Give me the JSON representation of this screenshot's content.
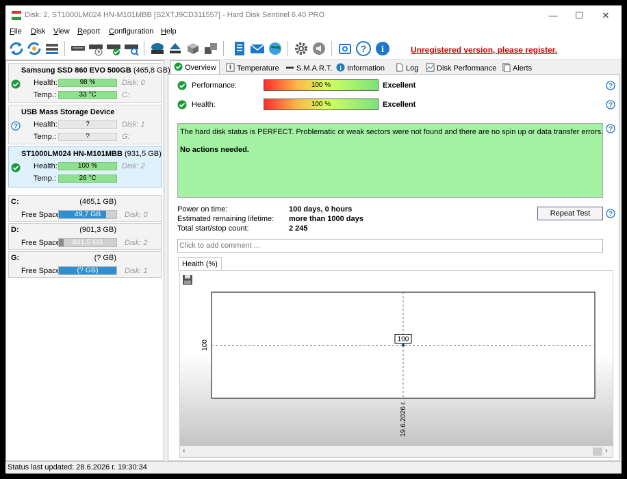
{
  "window": {
    "title": "Disk: 2, ST1000LM024 HN-M101MBB [S2XTJ9CD311557]  -  Hard Disk Sentinel 6.40 PRO"
  },
  "menu": [
    {
      "accel": "F",
      "rest": "ile"
    },
    {
      "accel": "D",
      "rest": "isk"
    },
    {
      "accel": "V",
      "rest": "iew"
    },
    {
      "accel": "R",
      "rest": "eport"
    },
    {
      "accel": "C",
      "rest": "onfiguration"
    },
    {
      "accel": "H",
      "rest": "elp"
    }
  ],
  "toolbar": {
    "register_text": "Unregistered version, please register."
  },
  "disks": [
    {
      "name": "Samsung SSD 860 EVO 500GB",
      "size": "(465,8 GB)",
      "health_label": "Health:",
      "health": "98 %",
      "temp_label": "Temp.:",
      "temp": "33 °C",
      "disk_ref": "Disk: 0",
      "drive": "C:"
    },
    {
      "name": "USB Mass Storage Device",
      "size": "",
      "health_label": "Health:",
      "health": "?",
      "temp_label": "Temp.:",
      "temp": "?",
      "disk_ref": "Disk: 1",
      "drive": "G:"
    },
    {
      "name": "ST1000LM024 HN-M101MBB",
      "size": "(931,5 GB)",
      "health_label": "Health:",
      "health": "100 %",
      "temp_label": "Temp.:",
      "temp": "26 °C",
      "disk_ref": "Disk: 2",
      "drive": ""
    }
  ],
  "partitions": [
    {
      "letter": "C:",
      "size": "(465,1 GB)",
      "label": "Free Space",
      "free": "49,7 GB",
      "fill": 0.82,
      "color": "#2f8fd0",
      "disk_ref": "Disk: 0"
    },
    {
      "letter": "D:",
      "size": "(901,3 GB)",
      "label": "Free Space",
      "free": "841,5 GB",
      "fill": 0.08,
      "color": "#8c8c8c",
      "disk_ref": "Disk: 2"
    },
    {
      "letter": "G:",
      "size": "(? GB)",
      "label": "Free Space",
      "free": "(? GB)",
      "fill": 1.0,
      "color": "#2f8fd0",
      "disk_ref": "Disk: 1"
    }
  ],
  "tabs": [
    {
      "label": "Overview",
      "icon": "check-icon"
    },
    {
      "label": "Temperature",
      "icon": "thermometer-icon"
    },
    {
      "label": "S.M.A.R.T.",
      "icon": "smart-icon"
    },
    {
      "label": "Information",
      "icon": "info-icon"
    },
    {
      "label": "Log",
      "icon": "log-icon"
    },
    {
      "label": "Disk Performance",
      "icon": "performance-icon"
    },
    {
      "label": "Alerts",
      "icon": "alerts-icon"
    }
  ],
  "overview": {
    "performance_label": "Performance:",
    "performance_value": "100 %",
    "performance_rating": "Excellent",
    "health_label": "Health:",
    "health_value": "100 %",
    "health_rating": "Excellent",
    "status_message": "The hard disk status is PERFECT. Problematic or weak sectors were not found and there are no spin up or data transfer errors.",
    "action_message": "No actions needed.",
    "power_on_label": "Power on time:",
    "power_on_value": "100 days, 0 hours",
    "lifetime_label": "Estimated remaining lifetime:",
    "lifetime_value": "more than 1000 days",
    "startstop_label": "Total start/stop count:",
    "startstop_value": "2 245",
    "repeat_button": "Repeat Test",
    "comment_placeholder": "Click to add comment ...",
    "chart_tab": "Health (%)"
  },
  "chart_data": {
    "type": "line",
    "title": "Health (%)",
    "x": [
      "19.6.2026 г."
    ],
    "series": [
      {
        "values": [
          100
        ]
      }
    ],
    "y_tick": "100",
    "point_label": "100",
    "grid": true
  },
  "status": {
    "text": "Status last updated: 28.6.2026 г. 19:30:34"
  },
  "colors": {
    "accent": "#2f8fd0",
    "health_green": "#8fe08f",
    "status_green": "#a3f1a3",
    "register_red": "#d00000"
  }
}
